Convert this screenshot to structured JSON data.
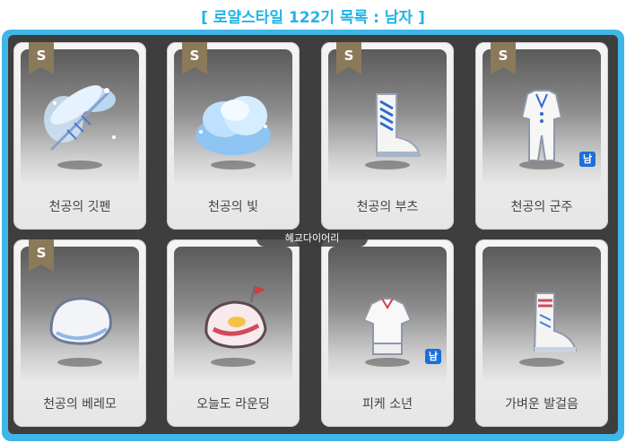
{
  "title": "[ 로얄스타일 122기 목록 : 남자 ]",
  "watermark": "혜교다이어리",
  "badge_letter": "S",
  "gender_badge": "남",
  "items": [
    {
      "name": "천공의 깃펜",
      "badge": true,
      "gender": false,
      "icon": "quill-pen-icon"
    },
    {
      "name": "천공의 빛",
      "badge": true,
      "gender": false,
      "icon": "cloud-light-icon"
    },
    {
      "name": "천공의 부츠",
      "badge": true,
      "gender": false,
      "icon": "boots-icon"
    },
    {
      "name": "천공의 군주",
      "badge": true,
      "gender": true,
      "icon": "white-suit-icon"
    },
    {
      "name": "천공의 베레모",
      "badge": true,
      "gender": false,
      "icon": "beret-icon"
    },
    {
      "name": "오늘도 라운딩",
      "badge": false,
      "gender": false,
      "icon": "golf-cap-icon"
    },
    {
      "name": "피케 소년",
      "badge": false,
      "gender": true,
      "icon": "pique-shirt-icon"
    },
    {
      "name": "가벼운 발걸음",
      "badge": false,
      "gender": false,
      "icon": "sneakers-icon"
    }
  ]
}
